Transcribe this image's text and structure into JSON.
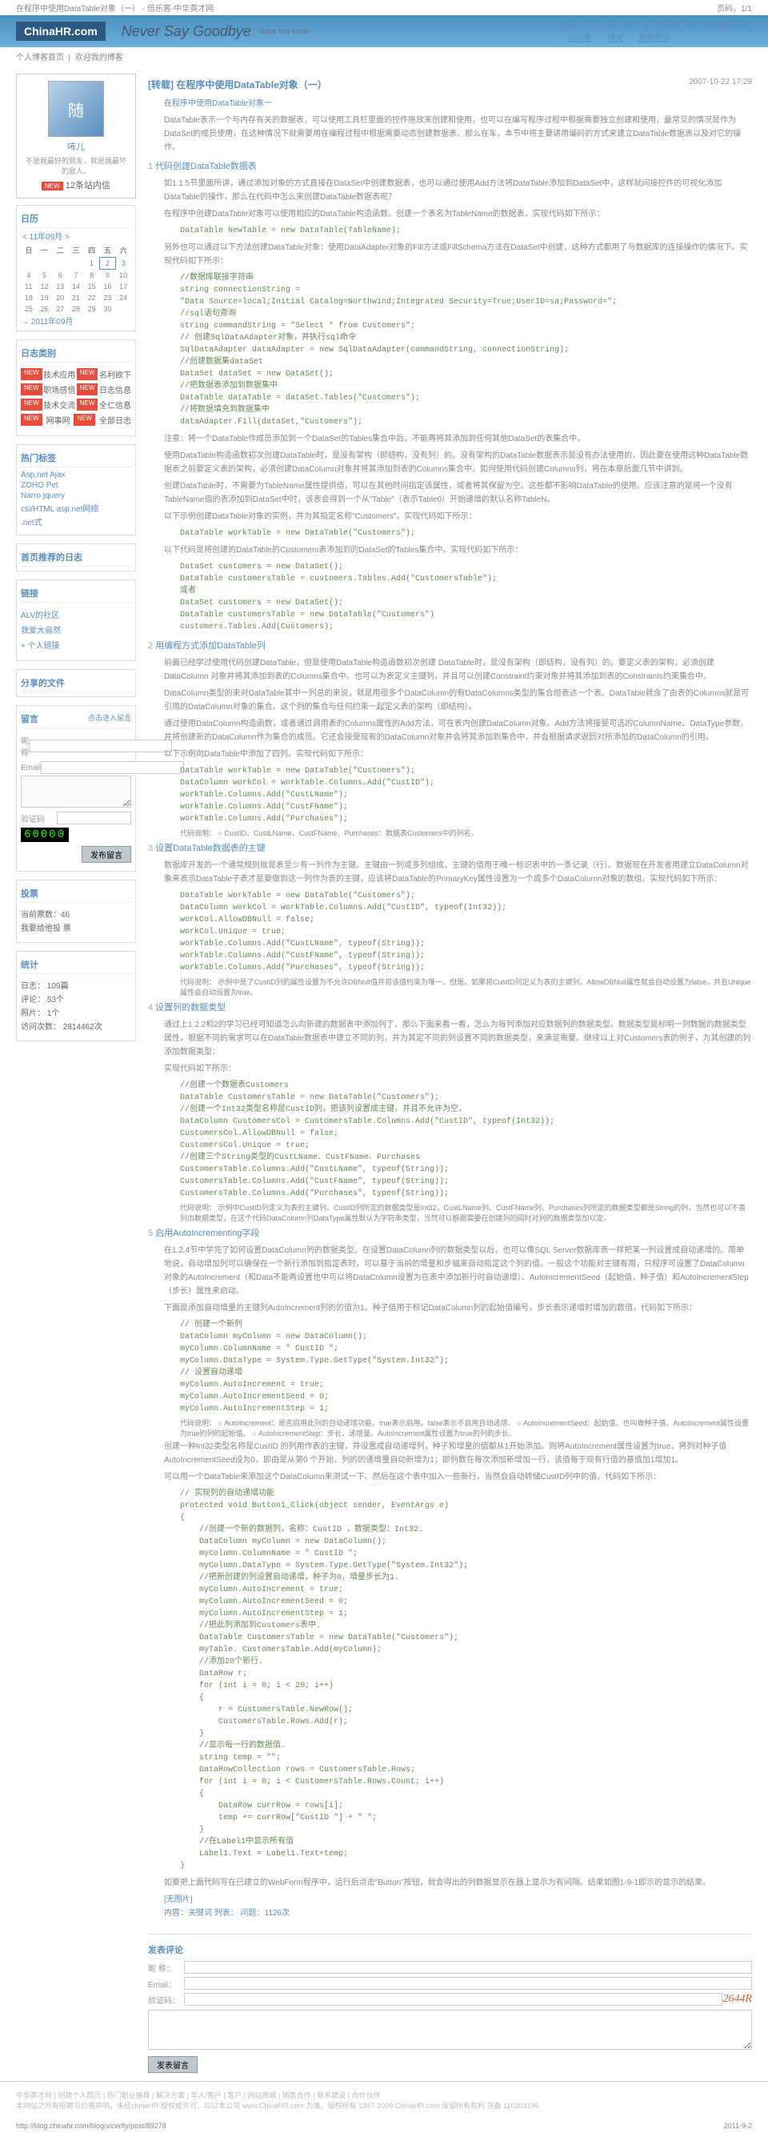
{
  "page": {
    "header_left": "在程序中使用DataTable对象（一） - 倍乐客-中华英才网",
    "header_right": "页码，1/1",
    "url": "http://blog.chinahr.com/blog/xicerfly/post/89278",
    "date": "2011-9-2"
  },
  "banner": {
    "logo": "ChinaHR.com",
    "logo_sub": "倍乐客",
    "title": "Never Say Goodbye",
    "subtitle": "Want You Know",
    "nav_welcome": "欢迎，ClaudeKiosk5！您 | 我的乐土网 | 欢迎你写日志",
    "nav_links": [
      "倍乐客",
      "博文",
      "管理首页"
    ]
  },
  "top_tabs": [
    "个人博客首页",
    "欢迎我的博客"
  ],
  "profile": {
    "nickname": "咘儿",
    "desc": "不是我最好的朋友，就是我最坏的敌人。",
    "msg_badge": "NEW",
    "msg_text": "12条站内信"
  },
  "calendar": {
    "header": "日历",
    "prev": "<",
    "month": "11年09月",
    "next": ">",
    "days": [
      "日",
      "一",
      "二",
      "三",
      "四",
      "五",
      "六"
    ],
    "weeks": [
      [
        "",
        "",
        "",
        "",
        "1",
        "2",
        "3"
      ],
      [
        "4",
        "5",
        "6",
        "7",
        "8",
        "9",
        "10"
      ],
      [
        "11",
        "12",
        "13",
        "14",
        "15",
        "16",
        "17"
      ],
      [
        "18",
        "19",
        "20",
        "21",
        "22",
        "23",
        "24"
      ],
      [
        "25",
        "26",
        "27",
        "28",
        "29",
        "30",
        ""
      ]
    ],
    "today": "2",
    "current": "→  2011年09月"
  },
  "categories": {
    "header": "日志类别",
    "items": [
      {
        "name": "技术应用",
        "count": "名利欲下"
      },
      {
        "name": "职场感悟",
        "count": "日志信息"
      },
      {
        "name": "技术交流",
        "count": "全仁信息"
      },
      {
        "name": "网事网",
        "count": "全部日志"
      }
    ]
  },
  "tags": {
    "header": "热门标签",
    "items": [
      "Asp.net    Ajax",
      "ZOHO       Pet",
      "Narro      jquery",
      "csi/HTML  asp.net网络",
      ".net式"
    ]
  },
  "recommend": {
    "header": "首页推荐的日志"
  },
  "links": {
    "header": "链接",
    "items": [
      "ALV的社区",
      "我爱大自然"
    ],
    "add": "+ 个人链接"
  },
  "files": {
    "header": "分享的文件"
  },
  "msgbox": {
    "header": "留言",
    "link": "点击进入留言",
    "name_label": "昵称",
    "email_label": "Email",
    "code_label": "验证码",
    "submit": "发布留言"
  },
  "vote": {
    "header": "投票",
    "text1": "当前票数：46",
    "text2": "我要给他投       票"
  },
  "stats": {
    "header": "统计",
    "lines": [
      "日志：   109篇",
      "评论：   53个",
      "照片：   1个",
      "访问次数：   2814462次"
    ],
    "counter": "60000"
  },
  "article": {
    "title": "[转载]  在程序中使用DataTable对象（一）",
    "date": "2007-10-22 17:29",
    "intro_label": "在程序中使用DataTable对象一",
    "intro": "DataTable表示一个与内存有关的数据表，可以使用工具栏里面的控件拖放来创建和使用，也可以在编写程序过程中根据需要独立创建和使用，最常见的情况是作为DataSet的成员使用，在这种情况下就需要用在编程过程中根据需要动态创建数据表。那么在车，本节中将主要讲用编码的方式来建立DataTable数据表以及对它的操作。",
    "s1": {
      "num": "1",
      "title": "代码创建DataTable数据表",
      "p1": "如1.1.5节里面所讲，通过添加对象的方式直接在DataSet中创建数据表，也可以通过使用Add方法将DataTable添加到DataSet中，这样就间接控件的可视化添加DataTable的操作，那么在代码中怎么来创建DataTable数据表呢？",
      "p2": "在程序中创建DataTable对象可以使用相应的DataTable构造函数。创建一个表名为TableName的数据表，实现代码如下所示：",
      "code1": "DataTable NewTable = new DataTable(TableName);",
      "p3": "另外也可以通过以下方法创建DataTable对象：使用DataAdapter对象的Fill方法或FillSchema方法在DataSet中创建，这种方式都用了与数据库的连接操作的情况下。实现代码如下所示：",
      "code2": "//数据库联接字符串\nstring connectionString =\n\"Data Source=local;Initial Catalog=Northwind;Integrated Security=True;UserID=sa;Password=\";\n//sql语句查询\nstring commandString = \"Select * from Customers\";\n// 创建SqlDataAdapter对象，并执行sql命令\nSqlDataAdapter dataAdapter = new SqlDataAdapter(commandString, connectionString);\n//创建数据集dataSet\nDataSet dataSet = new DataSet();\n//把数据表添加到数据集中\nDataTable dataTable = dataSet.Tables(\"Customers\");\n//将数据填充到数据集中\ndataAdapter.Fill(dataSet,\"Customers\");",
      "p4": "注意：将一个DataTable作成员添加到一个DataSet的Tables集合中后，不能再将其添加到任何其他DataSet的表集合中。",
      "p5": "使用DataTable构造函数初次创建DataTable时，是没有架构（即结构，没有列）的。没有架构的DataTable数据表示是没有办法使用的，因此要在使用这种DataTable数据表之前要定义表的架构，必须创建DataColumn对象并将其添加到表的Columns集合中。如何使用代码创建Columns列，将在本章后面几节中讲到。",
      "p6": "创建DataTable时，不需要为TableName属性提供值，可以在其他时间指定该属性，或者将其保留为空。这些都不影响DataTable的使用。应该注意的是将一个没有TableName值的表添加到DataSet中时，该表会得到一个从\"Table\"（表示Table0）开始递增的默认名称TableN。",
      "p7": "以下示例创建DataTable对象的实例，并为其指定名称\"Customers\"。实现代码如下所示：",
      "code3": "DataTable workTable = new DataTable(\"Customers\");",
      "p8": "以下代码是将创建的DataTable的Customers表添加到的DataSet的Tables集合中。实现代码如下所示：",
      "code4": "DataSet customers = new DataSet();\nDataTable customersTable = customers.Tables.Add(\"CustomersTable\");\n或者\nDataSet customers = new DataSet();\nDataTable customersTable = new DataTable(\"Customers\")\ncustomers.Tables.Add(Customers);"
    },
    "s2": {
      "num": "2",
      "title": "用编程方式添加DataTable列",
      "p1": "前面已经学过使用代码创建DataTable，但是使用DataTable构造函数初次创建 DataTable时，是没有架构（即结构，没有列）的。要定义表的架构，必须创建DataColumn 对象并将其添加到表的Columns集合中。也可以为表定义主键列，并且可以创建Constraint约束对象并将其添加到表的Constraints约束集合中。",
      "p2": "DataColumn类型的来对DataTable其中一列总的来说，就是用很多个DataColumn的有DataColumns类型的集合组表达一个表。DataTable就含了由表的Columns就是可引用的DataColumn对象的集合。这个列的集合与任何约束一起定义表的架构（即结构）。",
      "p3": "通过使用DataColumn构造函数，或者通过调用表的Columns属性的Add方法，可在表内创建DataColumn对象。Add方法将接受可选的ColumnName、DataType参数，并将创建新的DataColumn作为集合的成员。它还会接受现有的DataColumn对象并会将其添加到集合中，并会根据请求返回对所添加的DataColumn的引用。",
      "p4": "以下示例向DataTable中添加了四列。实现代码如下所示：",
      "code1": "DataTable workTable = new DataTable(\"Customers\");\nDataColumn workCol = workTable.Columns.Add(\"CustID\");\nworkTable.Columns.Add(\"CustLName\");\nworkTable.Columns.Add(\"CustFName\");\nworkTable.Columns.Add(\"Purchases\");",
      "tip": "代码说明：\n○  CustID、CustLName、CustFName、Purchases：数据表Customers中的列名。"
    },
    "s3": {
      "num": "3",
      "title": "设置DataTable数据表的主键",
      "p1": "数据库开发的一个通常规则就是表至少有一列作为主键。主键由一列或多列组成，主键的值用于唯一标识表中的一条记录（行）。数据现在开发者用建立DataColumn对象来表示DataTable子表才是要做到这一列作为表的主键，应该将DataTable的PrimaryKey属性设置为一个或多个DataColumn对象的数组。实现代码如下所示：",
      "code1": "DataTable workTable = new DataTable(\"Customers\");\nDataColumn workCol = workTable.Columns.Add(\"CustID\", typeof(Int32));\nworkCol.AllowDBNull = false;\nworkCol.Unique = true;\nworkTable.Columns.Add(\"CustLName\", typeof(String));\nworkTable.Columns.Add(\"CustFName\", typeof(String));\nworkTable.Columns.Add(\"Purchases\", typeof(String));",
      "tip": "代码说明：\n示例中是了CustID列的属性设置为不允许DBNull值并将该值约束为唯一。但是，如果将CustID列定义为表的主键列，AllowDBNull属性就会自动设置为false，并且Unique属性会自动设置为true。"
    },
    "s4": {
      "num": "4",
      "title": "设置列的数据类型",
      "p1": "通过上1.2.2和2的学习已经可知道怎么向新建的数据表中添加列了，那么下面来看一看，怎么为每列添加对应数据列的数据类型。数据类型是标明一列数据的数据类型属性，根据不同的需求可以在DataTable数据表中建立不同的列，并为其定不同的列设置不同的数据类型，来满足需要。继续以上对Customers表的例子，为其创建的列添加数据类型：",
      "p2": "实现代码如下所示：",
      "code1": "//创建一个数据表Customers\nDataTable CustomersTable = new DataTable(\"Customers\");\n//创建一个Int32类型名称是CustID列，把该列设置成主键，并且不允许为空，\nDataColumn CustomersCol = CustomersTable.Columns.Add(\"CustID\", typeof(Int32));\nCustomersCol.AllowDBNull = false;\nCustomersCol.Unique = true;\n//创建三个String类型的CustLName、CustFName、Purchases\nCustomersTable.Columns.Add(\"CustLName\", typeof(String));\nCustomersTable.Columns.Add(\"CustFName\", typeof(String));\nCustomersTable.Columns.Add(\"Purchases\", typeof(String));",
      "tip": "代码说明：\n示例中CustID列定义为表的主键列。CustID列所定的数据类型是Int32，CustLName列、CustFName列、Purchases列所定的数据类型都是String的列，当然也可以不直列出数据类型，在这个代码DataColumn列DataType属性默认为字符串类型，当然可以根据需要在创建列的同时对列的数据类型加以定。"
    },
    "s5": {
      "num": "5",
      "title": "启用AutoIncrementing字段",
      "p1": "在1.2.4节中学完了如何设置DataColumn列的数据类型。在设置DataColumn列的数据类型以后，也可以像SQL Server数据库表一样把某一列设置成自动递增的。简单地说，自动增加列可以确保在一个新行添加到指定表时，可以基于当前的增量和步幅来自动指定这个列的值。一般这个功能对主键有用，只程序可设置了DataColumn对象的AutoIncrement（和Data不能再设置也中可以将DataColumn设置为在表中添加新行时自动递增）、AutoIncrementSeed（起始值，种子值）和AutoIncrementStep（步长）属性来启动。",
      "p2": "下面是添加自动增量的主键列AutoIncrement列的的值为1。种子值用于标记DataColumn列的起始值编号，步长表示递增时增加的数值，代码如下所示：",
      "code1": "// 创建一个新列\nDataColumn myColumn = new DataColumn();\nmyColumn.ColumnName = \" CustID \";\nmyColumn.DataType = System.Type.GetType(\"System.Int32\");\n// 设置自动递增\nmyColumn.AutoIncrement = true;\nmyColumn.AutoIncrementSeed = 0;\nmyColumn.AutoIncrementStep = 1;",
      "tip": "代码说明：\n○  AutoIncrement：是否启用此列的自动递增功能，true表示启用，false表示不启用自动递增。\n○  AutoIncrementSeed：起始值，也叫做种子值。AutoIncrement属性设置为true的列的起始值。\n○  AutoIncrementStep：步长，递增量。AutoIncrement属性设置为true的列的步长。",
      "p3": "创建一种Int32类型名称是CustID 的列用作表的主键，并设置成自动递增列，种子和增量的值都从1开始添加。则将AutoIncrement属性设置为true，将列对种子值AutoIncrementSeed设为0，即由是从第0 个开始，列的的递增量自动新增为1；即列数在每次添加新增加一行，该值每于现有行值的基值加1增加1。",
      "p4": "可以用一个DataTable来添加这个DataColumn来测试一下。然后在这个表中加入一些新行，当然会自动转储CustID列中的值，代码如下所示：",
      "code2": "// 实现列的自动递增功能\nprotected void Button1_Click(object sender, EventArgs e)\n{\n    //创建一个新的数据列，名称：CustID ，数据类型：Int32.\n    DataColumn myColumn = new DataColumn();\n    myColumn.ColumnName = \" CustID \";\n    myColumn.DataType = System.Type.GetType(\"System.Int32\");\n    //把新创建的列设置自动递增，种子为0，增量步长为1.\n    myColumn.AutoIncrement = true;\n    myColumn.AutoIncrementSeed = 0;\n    myColumn.AutoIncrementStep = 1;\n    //把此列添加到Customers表中.\n    DataTable CustomersTable = new DataTable(\"Customers\");\n    myTable. CustomersTable.Add(myColumn);\n    //添加20个新行.\n    DataRow r;\n    for (int i = 0; i < 20; i++)\n    {\n        r = CustomersTable.NewRow();\n        CustomersTable.Rows.Add(r);\n    }\n    //显示每一行的数据值.\n    string temp = \"\";\n    DataRowCollection rows = CustomersTable.Rows;\n    for (int i = 0; i < CustomersTable.Rows.Count; i++)\n    {\n        DataRow currRow = rows[i];\n        temp += currRow[\"CustID \"] + \" \";\n    }\n    //在Label1中显示所有值\n    Label1.Text = Label1.Text+temp;\n}",
      "p5": "如要把上面代码写在已建立的WebForm程序中，运行后点击\"Button\"按钮，就会得出的列数据显示在器上显示为有间隔。结果如图1-9-1即示的显示的结果。",
      "result_label": "[无图片]\n内容：关键词      列表：      问题：1126次"
    },
    "comment": {
      "header": "发表评论",
      "name": "昵 称：",
      "email": "Email：",
      "code": "验证码：",
      "captcha": "2644R",
      "submit": "发表留言"
    }
  },
  "footer": {
    "line1": "中华英才网  |  创建个人简历  |  热门职业推荐  |  解决方案  |  年人/客户  |  客户  |  网站商城  |  销售合作  |  联系建议  |  合作伙伴",
    "line2": "本网站之所有招聘与价格声明，未经chinaHR 授权或许可。均以本公司 www.ChinaHR.com 为准。版权所有 1997-2009 ChinaHR.com 保留所有权利  京备 110303195"
  }
}
